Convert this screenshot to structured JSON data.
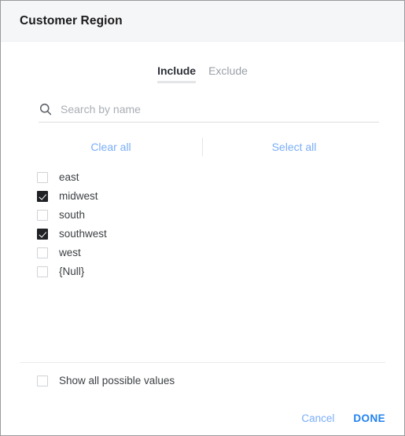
{
  "dialog": {
    "title": "Customer Region"
  },
  "tabs": [
    {
      "label": "Include",
      "active": true
    },
    {
      "label": "Exclude",
      "active": false
    }
  ],
  "search": {
    "placeholder": "Search by name",
    "value": "",
    "icon": "search-icon"
  },
  "linkbar": {
    "clear_all": "Clear all",
    "select_all": "Select all"
  },
  "options": [
    {
      "label": "east",
      "checked": false
    },
    {
      "label": "midwest",
      "checked": true
    },
    {
      "label": "south",
      "checked": false
    },
    {
      "label": "southwest",
      "checked": true
    },
    {
      "label": "west",
      "checked": false
    },
    {
      "label": "{Null}",
      "checked": false
    }
  ],
  "show_all": {
    "label": "Show all possible values",
    "checked": false
  },
  "actions": {
    "cancel": "Cancel",
    "done": "DONE"
  },
  "colors": {
    "link_blue": "#7aaef8",
    "done_blue": "#2081f0",
    "checkbox_checked": "#202124",
    "header_bg": "#f5f6f8",
    "text": "#3c4043"
  }
}
